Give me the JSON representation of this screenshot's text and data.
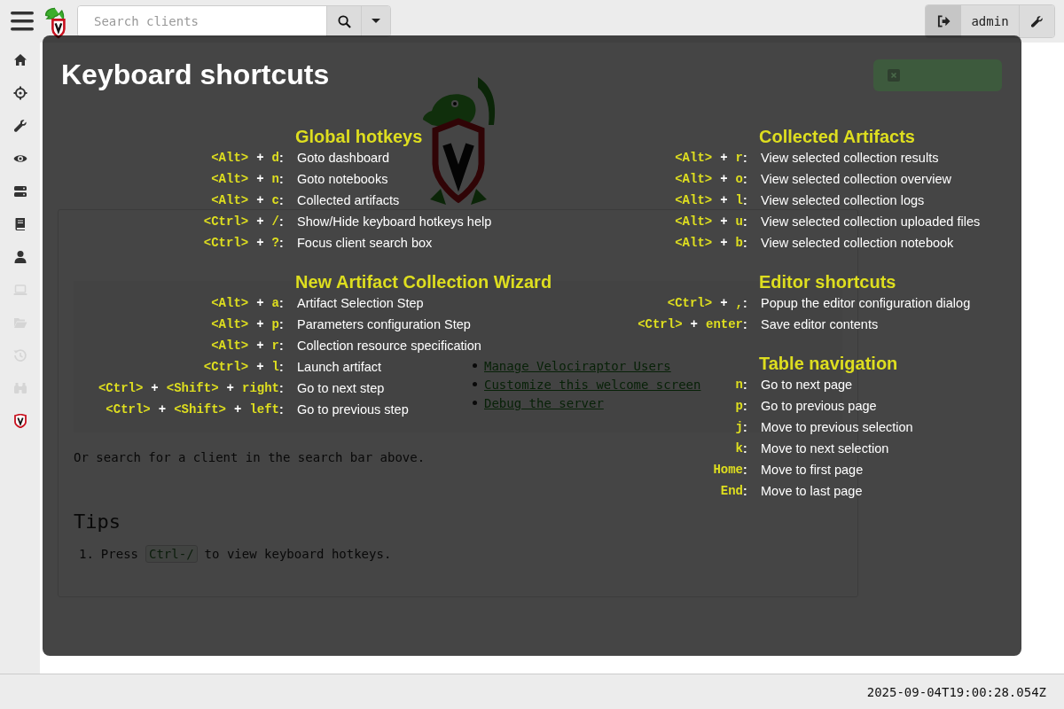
{
  "topbar": {
    "search": {
      "placeholder": "Search clients"
    },
    "user": "admin"
  },
  "sidebar": {
    "items": [
      {
        "disabled": false
      },
      {
        "disabled": false
      },
      {
        "disabled": false
      },
      {
        "disabled": false
      },
      {
        "disabled": false
      },
      {
        "disabled": false
      },
      {
        "disabled": false
      },
      {
        "disabled": true
      },
      {
        "disabled": true
      },
      {
        "disabled": true
      },
      {
        "disabled": true
      },
      {
        "disabled": false
      }
    ]
  },
  "welcome": {
    "links": [
      "Manage Velociraptor Users",
      "Customize this welcome screen",
      "Debug the server"
    ],
    "paragraphs": [
      "Or search for a client in the search bar above."
    ],
    "tips_title": "Tips",
    "tips": [
      {
        "number": "1.",
        "before": "Press",
        "key": "Ctrl-/",
        "after": "to view keyboard hotkeys."
      }
    ]
  },
  "modal": {
    "title": "Keyboard shortcuts",
    "columns": [
      [
        {
          "title": "Global hotkeys",
          "rows": [
            {
              "keys": [
                "<Alt>",
                "+",
                "d"
              ],
              "colon": ":",
              "text": "Goto dashboard"
            },
            {
              "keys": [
                "<Alt>",
                "+",
                "n"
              ],
              "colon": ":",
              "text": "Goto notebooks"
            },
            {
              "keys": [
                "<Alt>",
                "+",
                "c"
              ],
              "colon": ":",
              "text": "Collected artifacts"
            },
            {
              "keys": [
                "<Ctrl>",
                "+",
                "/"
              ],
              "colon": ":",
              "text": "Show/Hide keyboard hotkeys help"
            },
            {
              "keys": [
                "<Ctrl>",
                "+",
                "?"
              ],
              "colon": ":",
              "text": "Focus client search box"
            }
          ]
        },
        {
          "title": "New Artifact Collection Wizard",
          "rows": [
            {
              "keys": [
                "<Alt>",
                "+",
                "a"
              ],
              "colon": ":",
              "text": "Artifact Selection Step"
            },
            {
              "keys": [
                "<Alt>",
                "+",
                "p"
              ],
              "colon": ":",
              "text": "Parameters configuration Step"
            },
            {
              "keys": [
                "<Alt>",
                "+",
                "r"
              ],
              "colon": ":",
              "text": "Collection resource specification"
            },
            {
              "keys": [
                "<Ctrl>",
                "+",
                "l"
              ],
              "colon": ":",
              "text": "Launch artifact"
            },
            {
              "keys": [
                "<Ctrl>",
                "+",
                "<Shift>",
                "+",
                "right"
              ],
              "colon": ":",
              "text": "Go to next step"
            },
            {
              "keys": [
                "<Ctrl>",
                "+",
                "<Shift>",
                "+",
                "left"
              ],
              "colon": ":",
              "text": "Go to previous step"
            }
          ]
        }
      ],
      [
        {
          "title": "Collected Artifacts",
          "rows": [
            {
              "keys": [
                "<Alt>",
                "+",
                "r"
              ],
              "colon": ":",
              "text": "View selected collection results"
            },
            {
              "keys": [
                "<Alt>",
                "+",
                "o"
              ],
              "colon": ":",
              "text": "View selected collection overview"
            },
            {
              "keys": [
                "<Alt>",
                "+",
                "l"
              ],
              "colon": ":",
              "text": "View selected collection logs"
            },
            {
              "keys": [
                "<Alt>",
                "+",
                "u"
              ],
              "colon": ":",
              "text": "View selected collection uploaded files"
            },
            {
              "keys": [
                "<Alt>",
                "+",
                "b"
              ],
              "colon": ":",
              "text": "View selected collection notebook"
            }
          ]
        },
        {
          "title": "Editor shortcuts",
          "rows": [
            {
              "keys": [
                "<Ctrl>",
                "+",
                ","
              ],
              "colon": ":",
              "text": "Popup the editor configuration dialog"
            },
            {
              "keys": [
                "<Ctrl>",
                "+",
                "enter"
              ],
              "colon": ":",
              "text": "Save editor contents"
            }
          ]
        },
        {
          "title": "Table navigation",
          "rows": [
            {
              "keys": [
                "n"
              ],
              "colon": ":",
              "text": "Go to next page"
            },
            {
              "keys": [
                "p"
              ],
              "colon": ":",
              "text": "Go to previous page"
            },
            {
              "keys": [
                "j"
              ],
              "colon": ":",
              "text": "Move to previous selection"
            },
            {
              "keys": [
                "k"
              ],
              "colon": ":",
              "text": "Move to next selection"
            },
            {
              "keys": [
                "Home"
              ],
              "colon": ":",
              "text": "Move to first page"
            },
            {
              "keys": [
                "End"
              ],
              "colon": ":",
              "text": "Move to last page"
            }
          ]
        }
      ]
    ]
  },
  "status_bar": {
    "time": "2025-09-04T19:00:28.054Z"
  }
}
